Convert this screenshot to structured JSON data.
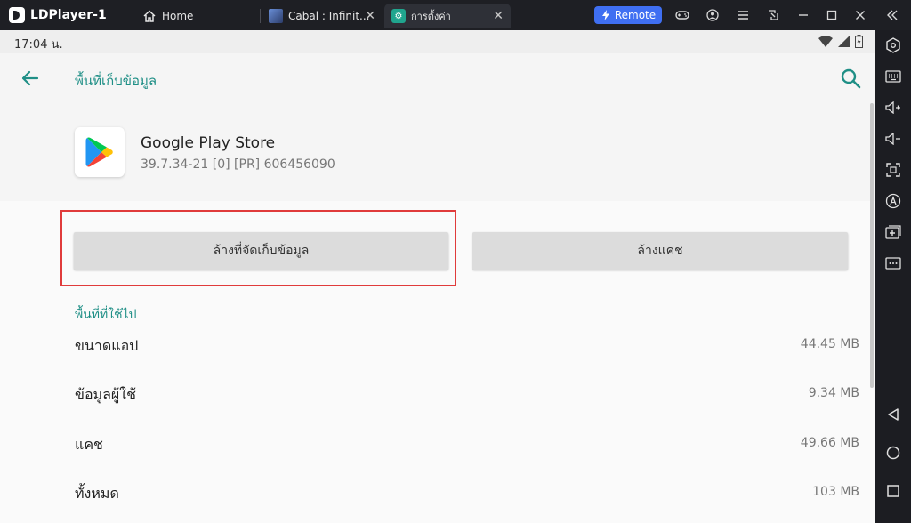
{
  "titlebar": {
    "app_name": "LDPlayer-1",
    "tabs": [
      {
        "label": "Home",
        "icon": "home-icon"
      },
      {
        "label": "Cabal : Infinit...",
        "icon": "game-thumbnail-icon"
      },
      {
        "label": "การตั้งค่า",
        "icon": "settings-app-icon"
      }
    ],
    "remote_label": "Remote"
  },
  "statusbar": {
    "time": "17:04 น."
  },
  "appbar": {
    "title": "พื้นที่เก็บข้อมูล"
  },
  "app": {
    "name": "Google Play Store",
    "version": "39.7.34-21 [0] [PR] 606456090"
  },
  "actions": {
    "clear_storage": "ล้างที่จัดเก็บข้อมูล",
    "clear_cache": "ล้างแคช"
  },
  "storage": {
    "section_title": "พื้นที่ที่ใช้ไป",
    "rows": [
      {
        "label": "ขนาดแอป",
        "value": "44.45 MB"
      },
      {
        "label": "ข้อมูลผู้ใช้",
        "value": "9.34 MB"
      },
      {
        "label": "แคช",
        "value": "49.66 MB"
      },
      {
        "label": "ทั้งหมด",
        "value": "103 MB"
      }
    ]
  },
  "colors": {
    "accent": "#1f8f86",
    "highlight": "#e03b3b",
    "remote": "#3f6ff2"
  }
}
